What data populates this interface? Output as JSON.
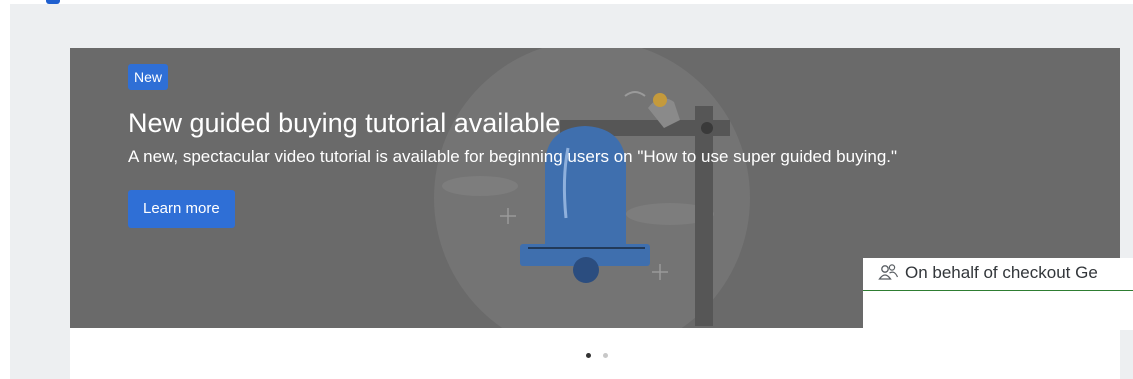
{
  "banner": {
    "badge": "New",
    "title": "New guided buying tutorial available",
    "description": "A new, spectacular video tutorial is available for beginning users on \"How to use super guided buying.\"",
    "cta_label": "Learn more"
  },
  "carousel": {
    "dots": [
      {
        "active": true
      },
      {
        "active": false
      }
    ]
  },
  "on_behalf_of": {
    "label": "On behalf of checkout Ge",
    "icon": "user-group-icon"
  },
  "colors": {
    "banner_bg": "#6a6a6a",
    "accent": "#2f6fd6",
    "page_bg": "#edeff1",
    "underline": "#2e7d32"
  }
}
